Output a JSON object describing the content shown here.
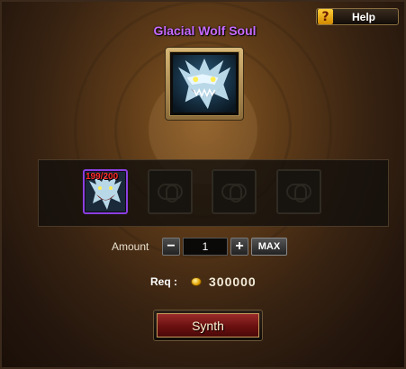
{
  "help": {
    "icon": "question-icon",
    "icon_glyph": "?",
    "label": "Help"
  },
  "target": {
    "name": "Glacial Wolf Soul",
    "portrait_icon": "wolf-portrait-icon",
    "name_color": "#c86bff"
  },
  "materials": {
    "slots": [
      {
        "state": "filled",
        "icon": "wolf-soul-icon",
        "count": "199/200"
      },
      {
        "state": "empty",
        "icon": "empty-slot-icon"
      },
      {
        "state": "empty",
        "icon": "empty-slot-icon"
      },
      {
        "state": "empty",
        "icon": "empty-slot-icon"
      }
    ]
  },
  "amount": {
    "label": "Amount",
    "value": "1",
    "minus": "−",
    "plus": "+",
    "max_label": "MAX"
  },
  "requirement": {
    "label": "Req :",
    "currency_icon": "gold-coin-icon",
    "value": "300000"
  },
  "synth": {
    "label": "Synth"
  },
  "colors": {
    "accent_purple": "#c86bff",
    "cost_red": "#ff2e2e",
    "button_red": "#7a1a1a"
  }
}
